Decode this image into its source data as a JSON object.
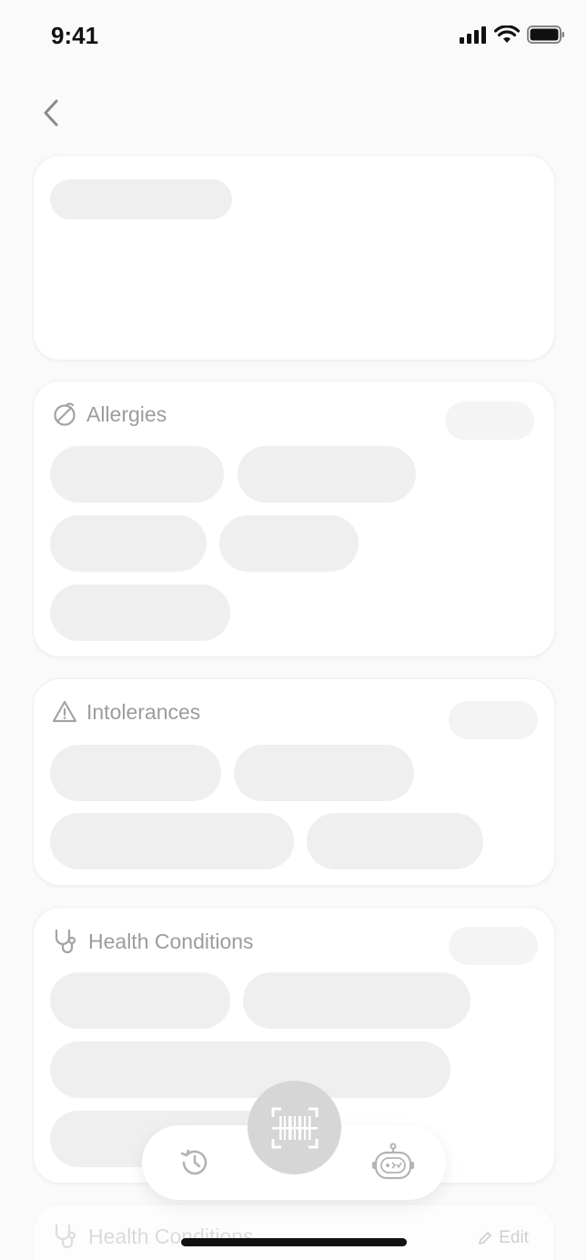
{
  "status_bar": {
    "time": "9:41"
  },
  "sections": {
    "allergies": {
      "title": "Allergies"
    },
    "intolerances": {
      "title": "Intolerances"
    },
    "health_conditions": {
      "title": "Health Conditions"
    },
    "health_conditions_2": {
      "title": "Health Conditions",
      "edit_label": "Edit"
    }
  },
  "icons": {
    "back": "chevron-left-icon",
    "allergies": "allergy-icon",
    "intolerances": "warning-triangle-icon",
    "health_conditions": "stethoscope-icon",
    "scan": "barcode-scan-icon",
    "history": "history-icon",
    "assistant": "robot-icon"
  },
  "colors": {
    "skeleton": "#efefef",
    "scan_button": "#d6d6d6",
    "text_muted": "#9c9c9c"
  }
}
